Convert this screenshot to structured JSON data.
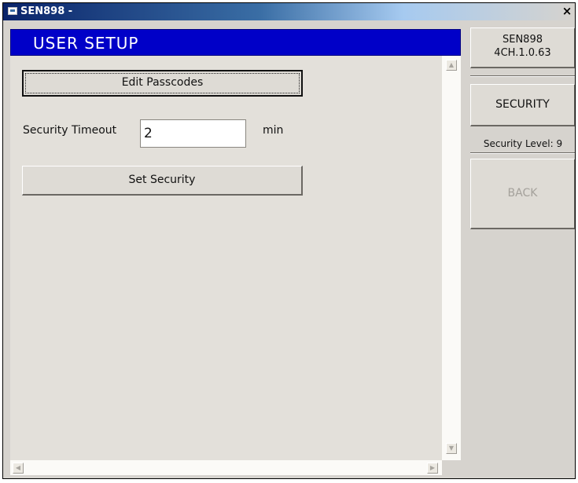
{
  "window": {
    "title": "SEN898 -",
    "close_glyph": "×"
  },
  "panel": {
    "title": "USER SETUP"
  },
  "buttons": {
    "edit_passcodes": "Edit Passcodes",
    "set_security": "Set Security",
    "security": "SECURITY",
    "back": "BACK"
  },
  "security_timeout": {
    "label": "Security Timeout",
    "value": "2",
    "unit": "min"
  },
  "sidebar": {
    "device_name": "SEN898",
    "version": "4CH.1.0.63",
    "security_level": "Security Level: 9"
  },
  "scrollbars": {
    "up_glyph": "▲",
    "down_glyph": "▼",
    "left_glyph": "◀",
    "right_glyph": "▶"
  },
  "colors": {
    "title_bar": "#0a246a",
    "panel_header": "#0000c8",
    "window_bg": "#d6d3ce",
    "content_bg": "#e3e0da"
  },
  "icons": {
    "window_icon": "app-window-icon",
    "close": "close-icon"
  }
}
